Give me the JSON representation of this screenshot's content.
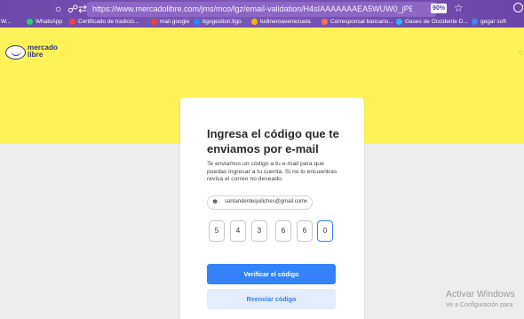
{
  "browser": {
    "url": "https://www.mercadolibre.com/jms/mco/lgz/email-validation/H4sIAAAAAAAEA5WUW0_jPBCG_4sv9iptznFSCe1",
    "zoom": "90%",
    "edge_text": "← →",
    "bookmarks": [
      {
        "label": "W...",
        "color": "#ffffff"
      },
      {
        "label": "WhatsApp",
        "color": "#25d366"
      },
      {
        "label": "Certificado de tradició...",
        "color": "#f44336"
      },
      {
        "label": "mail.google",
        "color": "#ea4335"
      },
      {
        "label": "tigogestion.tigo",
        "color": "#1e90ff"
      },
      {
        "label": "tudineroavenezuela",
        "color": "#f4b400"
      },
      {
        "label": "Corresponsal bancario...",
        "color": "#ff7043"
      },
      {
        "label": "Gases de Occidente D...",
        "color": "#29b6f6"
      },
      {
        "label": "gegar soft",
        "color": "#4285f4"
      }
    ]
  },
  "header": {
    "logo_line1": "mercado",
    "logo_line2": "libre",
    "bg_color": "#fff159"
  },
  "verification": {
    "title": "Ingresa el código que te enviamos por e-mail",
    "description": "Te enviamos un código a tu e-mail para que puedas ingresar a tu cuenta. Si no lo encuentras revisa el correo no deseado.",
    "email": "santanderdequiliches@gmail.com",
    "digits": [
      "5",
      "4",
      "3",
      "6",
      "6",
      "0"
    ],
    "verify_button": "Verificar el código",
    "resend_button": "Reenviar código"
  },
  "watermark": {
    "title": "Activar Windows",
    "subtitle": "Ve a Configuración para"
  }
}
